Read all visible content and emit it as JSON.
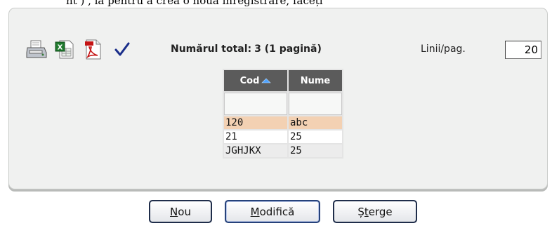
{
  "header": {
    "text": "nt ) , ia pentru a crea o nouă înregistrare, faceți"
  },
  "toolbar": {
    "icons": [
      "printer-icon",
      "excel-icon",
      "pdf-icon",
      "checkmark-icon"
    ],
    "total_label": "Numărul total:",
    "total_value": "3 (1 pagină)",
    "lines_label": "Linii/pag.",
    "lines_value": "20"
  },
  "table": {
    "columns": [
      "Cod",
      "Nume"
    ],
    "sort_icon": "sort-ascending-icon",
    "rows": [
      [
        "120",
        "abc"
      ],
      [
        "21",
        "25"
      ],
      [
        "JGHJKX",
        "25"
      ]
    ]
  },
  "buttons": {
    "nou": {
      "accel": "N",
      "rest": "ou"
    },
    "modifica": {
      "accel": "M",
      "rest": "odifică"
    },
    "sterge": {
      "pre": "Ș",
      "accel": "t",
      "rest": "erge"
    }
  },
  "colors": {
    "panel_bg": "#f0f1f0",
    "header_bg": "#5b5b5b",
    "selected_row": "#f3d1b3",
    "check": "#1a2e8a",
    "button_border": "#1f2d4a"
  }
}
